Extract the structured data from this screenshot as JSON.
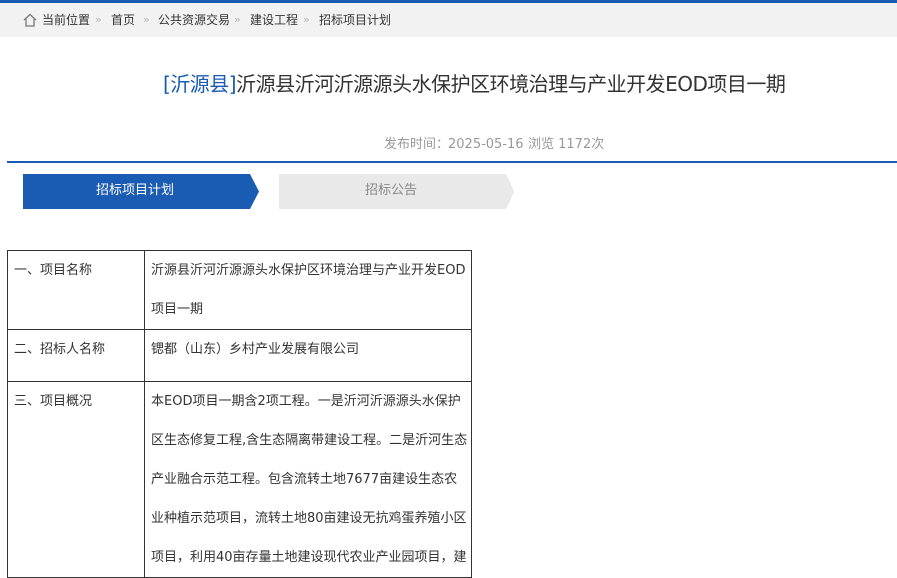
{
  "breadcrumb": {
    "current_location": "当前位置",
    "items": [
      "首页",
      "公共资源交易",
      "建设工程",
      "招标项目计划"
    ],
    "separator": "»"
  },
  "article": {
    "county_tag": "[沂源县]",
    "title": "沂源县沂河沂源源头水保护区环境治理与产业开发EOD项目一期",
    "publish_label": "发布时间：",
    "publish_date": "2025-05-16",
    "views_label": "浏览 1172次"
  },
  "steps": [
    {
      "label": "招标项目计划",
      "active": true
    },
    {
      "label": "招标公告",
      "active": false
    }
  ],
  "table": {
    "rows": [
      {
        "key": "一、项目名称",
        "lines": [
          "沂源县沂河沂源源头水保护区环境治理与产业开发EOD",
          "项目一期"
        ]
      },
      {
        "key": "二、招标人名称",
        "lines": [
          "锶都（山东）乡村产业发展有限公司"
        ]
      },
      {
        "key": "三、项目概况",
        "lines": [
          "本EOD项目一期含2项工程。一是沂河沂源源头水保护",
          "区生态修复工程,含生态隔离带建设工程。二是沂河生态",
          "产业融合示范工程。包含流转土地7677亩建设生态农",
          "业种植示范项目，流转土地80亩建设无抗鸡蛋养殖小区",
          "项目，利用40亩存量土地建设现代农业产业园项目，建"
        ]
      }
    ]
  },
  "colors": {
    "accent": "#1a5bb4",
    "breadcrumb_bg": "#f2f2f2",
    "step_inactive_bg": "#e9e9e9",
    "meta_text": "#999999"
  }
}
